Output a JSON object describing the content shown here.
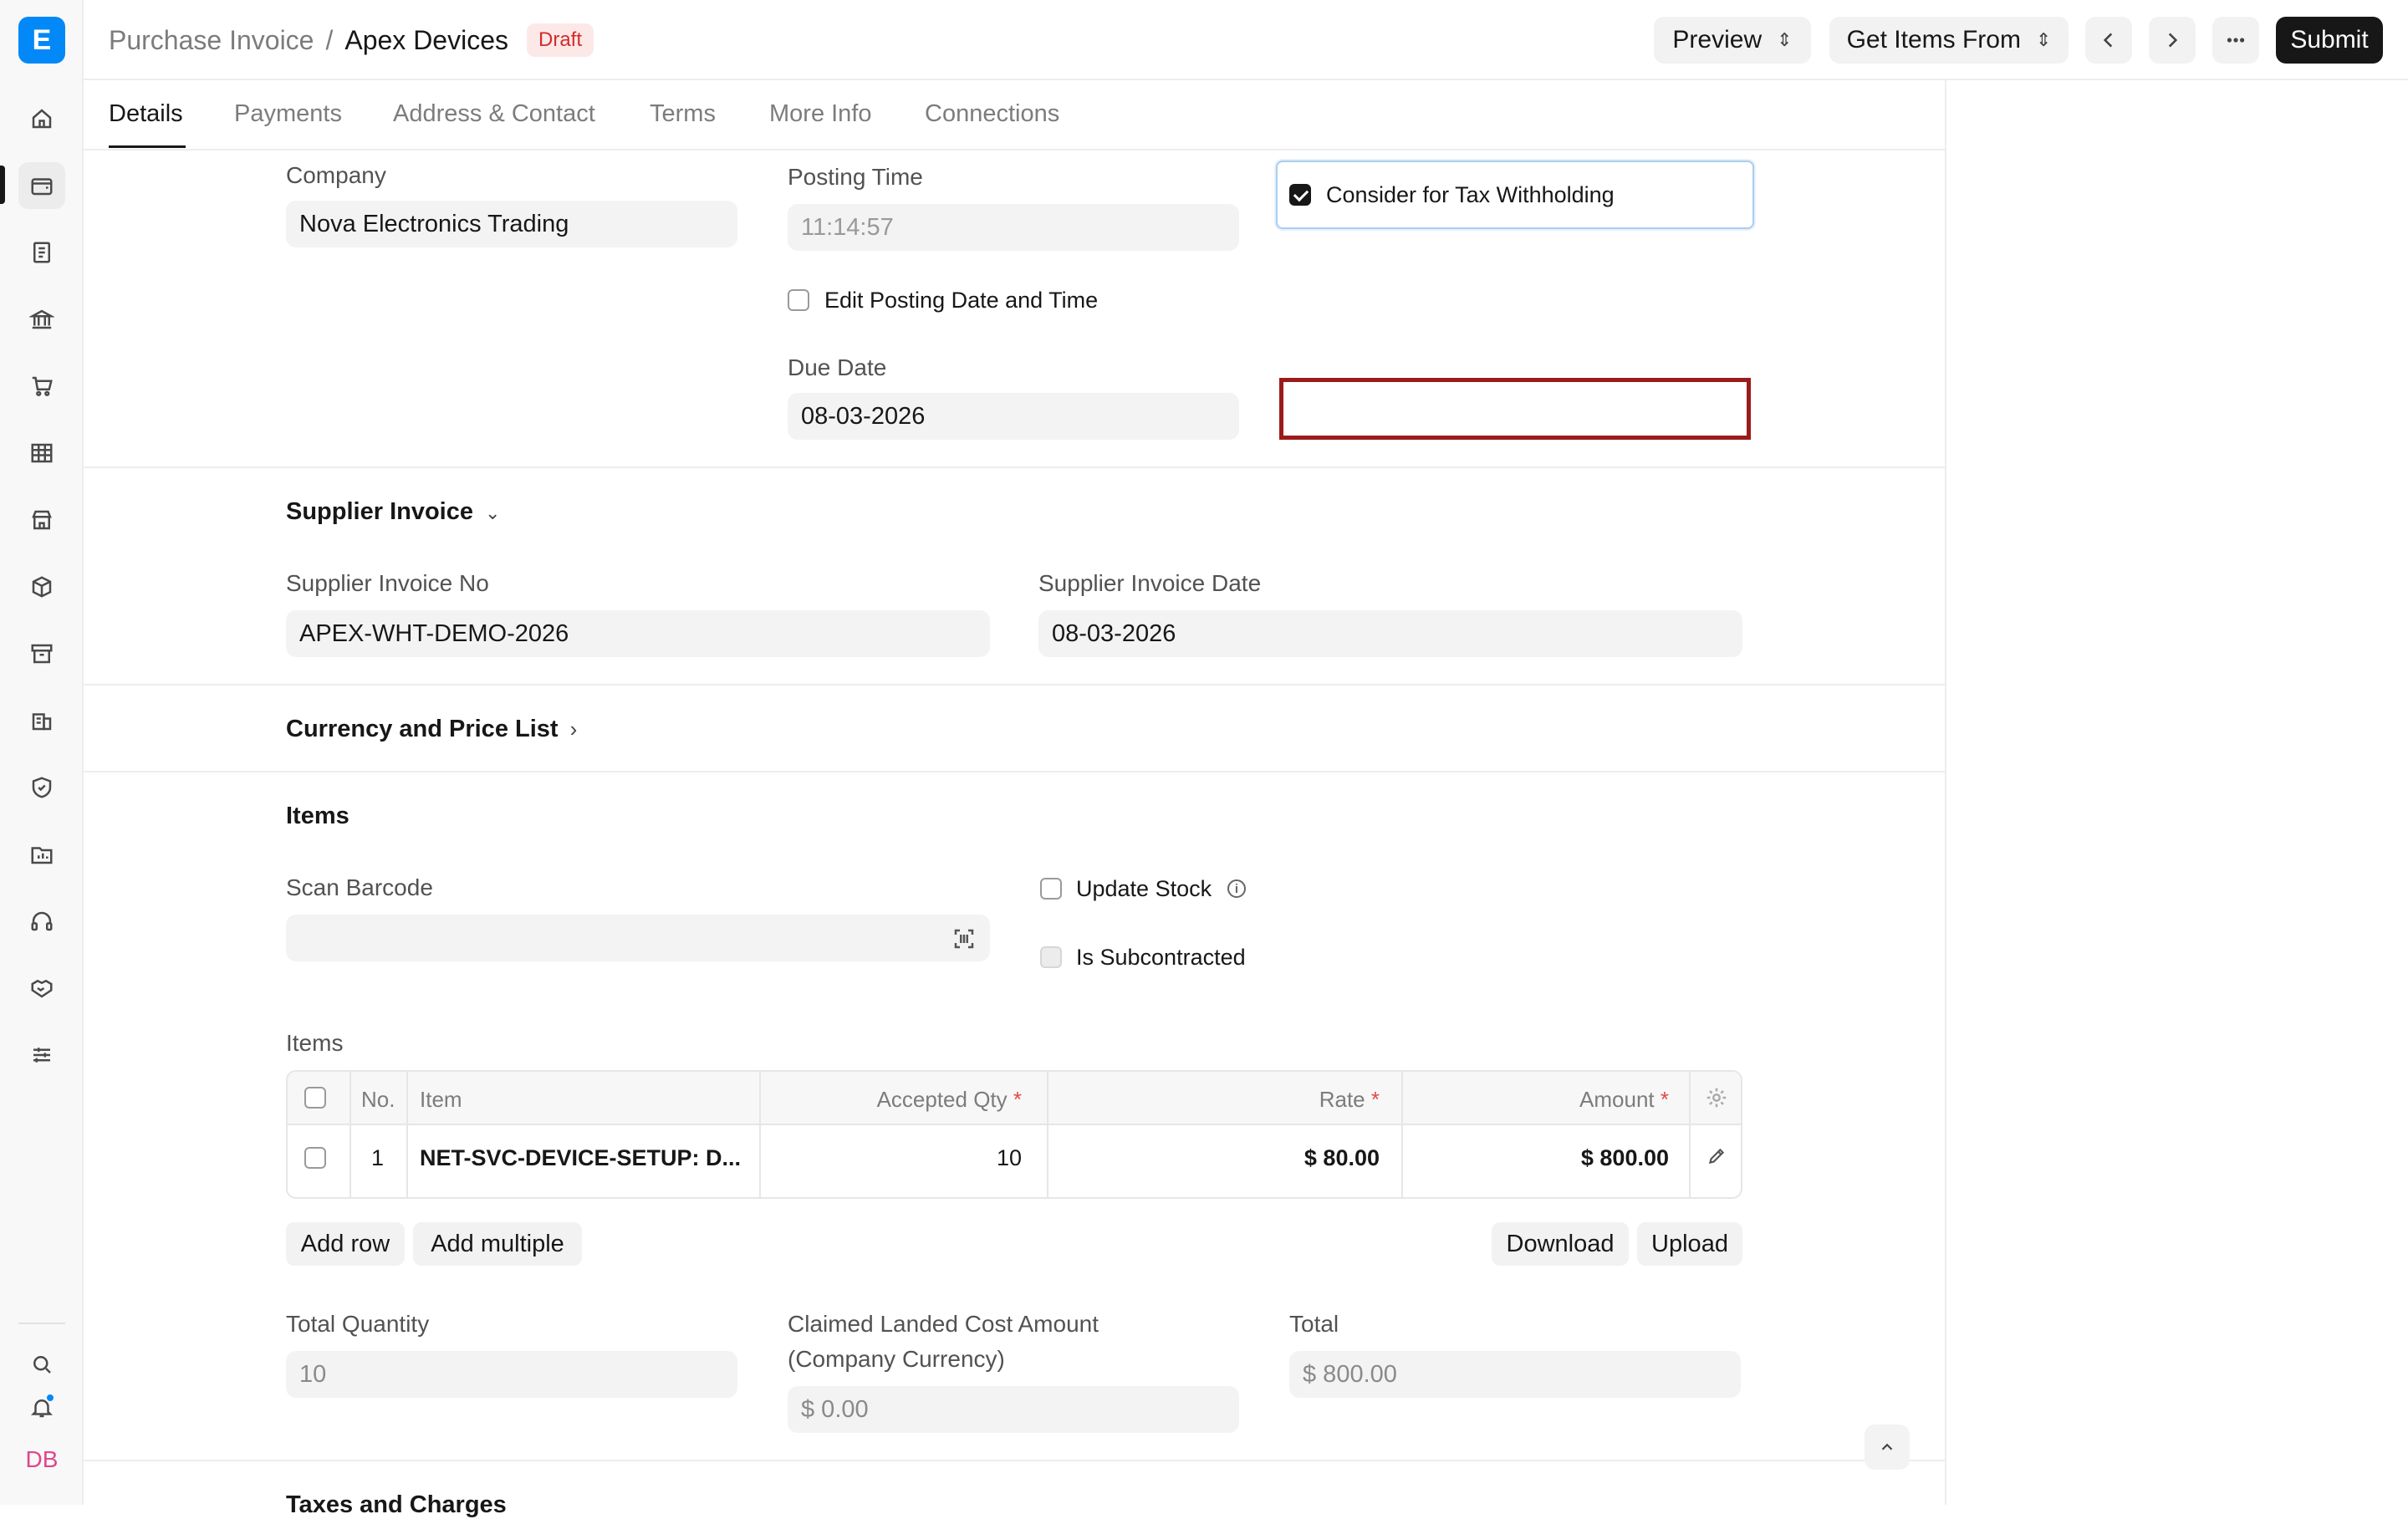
{
  "header": {
    "parent": "Purchase Invoice",
    "separator": "/",
    "title": "Apex Devices",
    "status": "Draft",
    "preview_label": "Preview",
    "get_items_label": "Get Items From",
    "submit_label": "Submit"
  },
  "tabs": [
    "Details",
    "Payments",
    "Address & Contact",
    "Terms",
    "More Info",
    "Connections"
  ],
  "sidebar": {
    "logo": "E",
    "icons": [
      "home-icon",
      "wallet-icon",
      "receipt-icon",
      "bank-icon",
      "cart-icon",
      "table-icon",
      "store-icon",
      "package-icon",
      "archive-icon",
      "building-icon",
      "shield-icon",
      "folder-chart-icon",
      "headset-icon",
      "handshake-icon",
      "sliders-icon"
    ],
    "bottom_icons": [
      "search-icon",
      "bell-icon"
    ],
    "avatar_initials": "DB"
  },
  "form": {
    "company_label": "Company",
    "company_value": "Nova Electronics Trading",
    "posting_time_label": "Posting Time",
    "posting_time_value": "11:14:57",
    "tax_withholding_label": "Consider for Tax Withholding",
    "tax_withholding_checked": true,
    "edit_posting_label": "Edit Posting Date and Time",
    "due_date_label": "Due Date",
    "due_date_value": "08-03-2026"
  },
  "supplier_invoice": {
    "section_title": "Supplier Invoice",
    "no_label": "Supplier Invoice No",
    "no_value": "APEX-WHT-DEMO-2026",
    "date_label": "Supplier Invoice Date",
    "date_value": "08-03-2026"
  },
  "currency_section_title": "Currency and Price List",
  "items_section": {
    "section_title": "Items",
    "scan_barcode_label": "Scan Barcode",
    "update_stock_label": "Update Stock",
    "is_subcontracted_label": "Is Subcontracted",
    "table_label": "Items",
    "columns": {
      "no": "No.",
      "item": "Item",
      "accepted_qty": "Accepted Qty",
      "rate": "Rate",
      "amount": "Amount",
      "required_mark": "*"
    },
    "rows": [
      {
        "no": "1",
        "item": "NET-SVC-DEVICE-SETUP: D...",
        "accepted_qty": "10",
        "rate": "$ 80.00",
        "amount": "$ 800.00"
      }
    ],
    "add_row_label": "Add row",
    "add_multiple_label": "Add multiple",
    "download_label": "Download",
    "upload_label": "Upload"
  },
  "totals": {
    "total_qty_label": "Total Quantity",
    "total_qty_value": "10",
    "landed_cost_label_1": "Claimed Landed Cost Amount",
    "landed_cost_label_2": "(Company Currency)",
    "landed_cost_value": "$ 0.00",
    "total_label": "Total",
    "total_value": "$ 800.00"
  },
  "next_section_title": "Taxes and Charges"
}
